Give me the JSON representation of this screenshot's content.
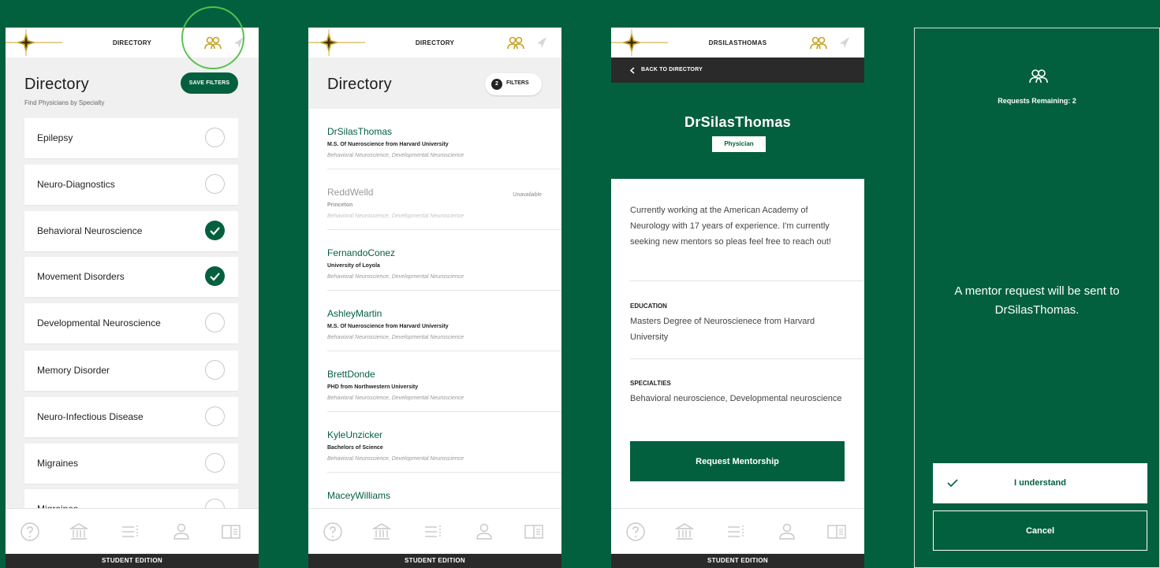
{
  "brand": {
    "primary": "#03603f",
    "gold": "#c9a227",
    "highlight": "#57c24d"
  },
  "edition_label": "STUDENT EDITION",
  "screen1": {
    "top_title": "DIRECTORY",
    "heading": "Directory",
    "subheading": "Find Physicians by Specialty",
    "save_filters": "SAVE FILTERS",
    "specialties": [
      {
        "label": "Epilepsy",
        "checked": false
      },
      {
        "label": "Neuro-Diagnostics",
        "checked": false
      },
      {
        "label": "Behavioral Neuroscience",
        "checked": true
      },
      {
        "label": "Movement Disorders",
        "checked": true
      },
      {
        "label": "Developmental Neuroscience",
        "checked": false
      },
      {
        "label": "Memory Disorder",
        "checked": false
      },
      {
        "label": "Neuro-Infectious Disease",
        "checked": false
      },
      {
        "label": "Migraines",
        "checked": false
      },
      {
        "label": "Migraines",
        "checked": false
      }
    ]
  },
  "screen2": {
    "top_title": "DIRECTORY",
    "heading": "Directory",
    "filter_count": "2",
    "filter_label": "FILTERS",
    "physicians": [
      {
        "name": "DrSilasThomas",
        "edu": "M.S. Of Nueroscience from Harvard University",
        "spec": "Behavioral Neuroscience, Developmental Neuroscience",
        "status": ""
      },
      {
        "name": "ReddWelld",
        "edu": "Princeton",
        "spec": "Behavioral Neuroscience, Developmental Neuroscience",
        "status": "Unavailable"
      },
      {
        "name": "FernandoConez",
        "edu": "University of Loyola",
        "spec": "Behavioral Neuroscience, Developmental Neuroscience",
        "status": ""
      },
      {
        "name": "AshleyMartin",
        "edu": "M.S. Of Nueroscience from Harvard University",
        "spec": "Behavioral Neuroscience, Developmental Neuroscience",
        "status": ""
      },
      {
        "name": "BrettDonde",
        "edu": "PHD from Northwestern University",
        "spec": "Behavioral Neuroscience, Developmental Neuroscience",
        "status": ""
      },
      {
        "name": "KyleUnzicker",
        "edu": "Bachelors of Science",
        "spec": "Behavioral Neuroscience, Developmental Neuroscience",
        "status": ""
      },
      {
        "name": "MaceyWilliams",
        "edu": "",
        "spec": "",
        "status": ""
      }
    ]
  },
  "screen3": {
    "top_title": "DRSILASTHOMAS",
    "back_label": "BACK TO DIRECTORY",
    "name": "DrSilasThomas",
    "role": "Physician",
    "bio": "Currently working at the American Academy of Neurology with 17 years of experience. I'm currently seeking new mentors so pleas feel free to reach out!",
    "education_heading": "EDUCATION",
    "education_text": "Masters Degree of Neuroscienece from Harvard University",
    "specialties_heading": "SPECIALTIES",
    "specialties_text": "Behavioral neuroscience, Developmental neuroscience",
    "request_button": "Request Mentorship"
  },
  "modal": {
    "remaining": "Requests Remaining: 2",
    "message": "A mentor request will be sent to DrSilasThomas.",
    "understand": "I understand",
    "cancel": "Cancel"
  }
}
